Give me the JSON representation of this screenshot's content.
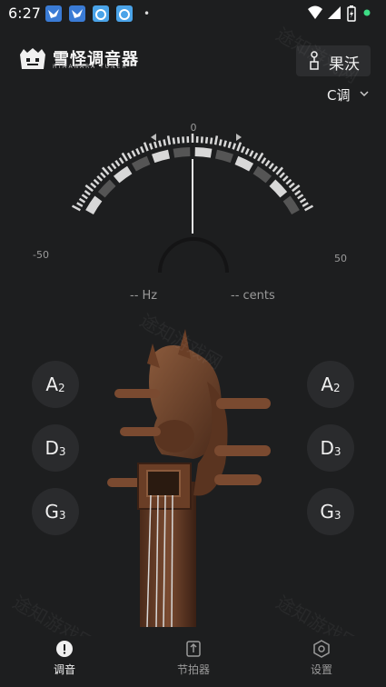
{
  "status_bar": {
    "time": "6:27",
    "notification_icons": [
      {
        "name": "bird-app-icon",
        "color": "#3a7bd5"
      },
      {
        "name": "bird-app-icon",
        "color": "#3a7bd5"
      },
      {
        "name": "swirl-app-icon",
        "color": "#4aa3e8"
      },
      {
        "name": "swirl-app-icon",
        "color": "#4aa3e8"
      }
    ],
    "more_indicator": "•"
  },
  "header": {
    "app_title": "雪怪调音器",
    "app_subtitle": "HIMANARA TUNER",
    "instrument_label": "果沃",
    "key_label": "C调"
  },
  "gauge": {
    "center_label": "0",
    "min_label": "-50",
    "max_label": "50",
    "needle_cents": 0
  },
  "readout": {
    "hz": "-- Hz",
    "cents": "-- cents"
  },
  "strings_left": [
    {
      "note": "A",
      "octave": "2"
    },
    {
      "note": "D",
      "octave": "3"
    },
    {
      "note": "G",
      "octave": "3"
    }
  ],
  "strings_right": [
    {
      "note": "A",
      "octave": "2"
    },
    {
      "note": "D",
      "octave": "3"
    },
    {
      "note": "G",
      "octave": "3"
    }
  ],
  "nav": {
    "items": [
      {
        "label": "调音",
        "icon": "tuner-icon",
        "active": true
      },
      {
        "label": "节拍器",
        "icon": "metronome-icon",
        "active": false
      },
      {
        "label": "设置",
        "icon": "settings-hexagon-icon",
        "active": false
      }
    ]
  },
  "watermark_text": "途知游戏网",
  "colors": {
    "background": "#1d1e1f",
    "gauge_light": "#d8d8d8",
    "gauge_dark": "#555555",
    "button_bg": "#2a2b2d"
  }
}
